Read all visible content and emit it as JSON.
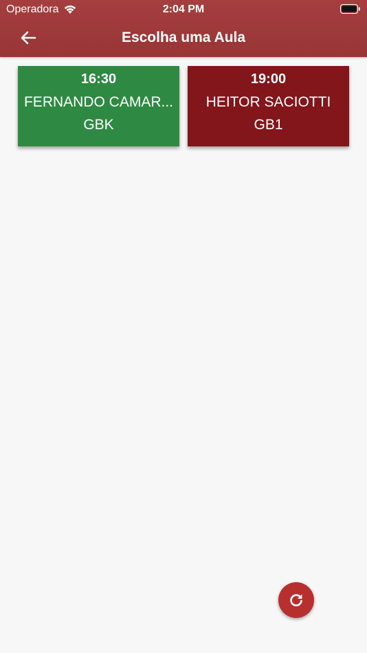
{
  "status_bar": {
    "carrier": "Operadora",
    "time": "2:04 PM"
  },
  "header": {
    "title": "Escolha uma Aula",
    "back_icon": "arrow-left-icon"
  },
  "classes": [
    {
      "time": "16:30",
      "instructor": "FERNANDO CAMAR...",
      "code": "GBK",
      "color": "#2e8a42"
    },
    {
      "time": "19:00",
      "instructor": "HEITOR SACIOTTI",
      "code": "GB1",
      "color": "#82161a"
    }
  ],
  "fab": {
    "icon": "refresh-icon",
    "color": "#b7302f"
  },
  "colors": {
    "header": "#a03a3b",
    "background": "#f7f7f7"
  }
}
